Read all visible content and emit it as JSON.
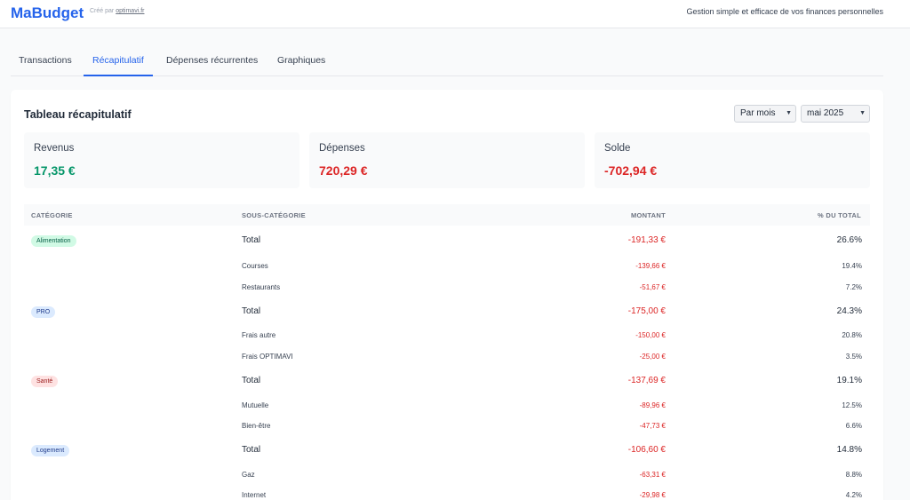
{
  "header": {
    "brand": "MaBudget",
    "created_prefix": "Créé par",
    "created_link": "optimavi.fr",
    "tagline": "Gestion simple et efficace de vos finances personnelles"
  },
  "tabs": [
    {
      "label": "Transactions",
      "active": false
    },
    {
      "label": "Récapitulatif",
      "active": true
    },
    {
      "label": "Dépenses récurrentes",
      "active": false
    },
    {
      "label": "Graphiques",
      "active": false
    }
  ],
  "summary": {
    "title": "Tableau récapitulatif",
    "period_select": "Par mois",
    "month_select": "mai 2025",
    "stats": [
      {
        "label": "Revenus",
        "value": "17,35 €",
        "color": "#059669"
      },
      {
        "label": "Dépenses",
        "value": "720,29 €",
        "color": "#dc2626"
      },
      {
        "label": "Solde",
        "value": "-702,94 €",
        "color": "#dc2626"
      }
    ]
  },
  "table": {
    "headers": [
      "CATÉGORIE",
      "SOUS-CATÉGORIE",
      "MONTANT",
      "% DU TOTAL"
    ],
    "groups": [
      {
        "category": "Alimentation",
        "badge_bg": "#d1fae5",
        "badge_fg": "#065f46",
        "total_label": "Total",
        "total_amount": "-191,33 €",
        "total_pct": "26.6%",
        "rows": [
          {
            "name": "Courses",
            "amount": "-139,66 €",
            "pct": "19.4%"
          },
          {
            "name": "Restaurants",
            "amount": "-51,67 €",
            "pct": "7.2%"
          }
        ]
      },
      {
        "category": "PRO",
        "badge_bg": "#dbeafe",
        "badge_fg": "#1e3a8a",
        "total_label": "Total",
        "total_amount": "-175,00 €",
        "total_pct": "24.3%",
        "rows": [
          {
            "name": "Frais autre",
            "amount": "-150,00 €",
            "pct": "20.8%"
          },
          {
            "name": "Frais OPTIMAVI",
            "amount": "-25,00 €",
            "pct": "3.5%"
          }
        ]
      },
      {
        "category": "Santé",
        "badge_bg": "#fee2e2",
        "badge_fg": "#991b1b",
        "total_label": "Total",
        "total_amount": "-137,69 €",
        "total_pct": "19.1%",
        "rows": [
          {
            "name": "Mutuelle",
            "amount": "-89,96 €",
            "pct": "12.5%"
          },
          {
            "name": "Bien-être",
            "amount": "-47,73 €",
            "pct": "6.6%"
          }
        ]
      },
      {
        "category": "Logement",
        "badge_bg": "#dbeafe",
        "badge_fg": "#1e3a8a",
        "total_label": "Total",
        "total_amount": "-106,60 €",
        "total_pct": "14.8%",
        "rows": [
          {
            "name": "Gaz",
            "amount": "-63,31 €",
            "pct": "8.8%"
          },
          {
            "name": "Internet",
            "amount": "-29,98 €",
            "pct": "4.2%"
          }
        ]
      }
    ]
  }
}
